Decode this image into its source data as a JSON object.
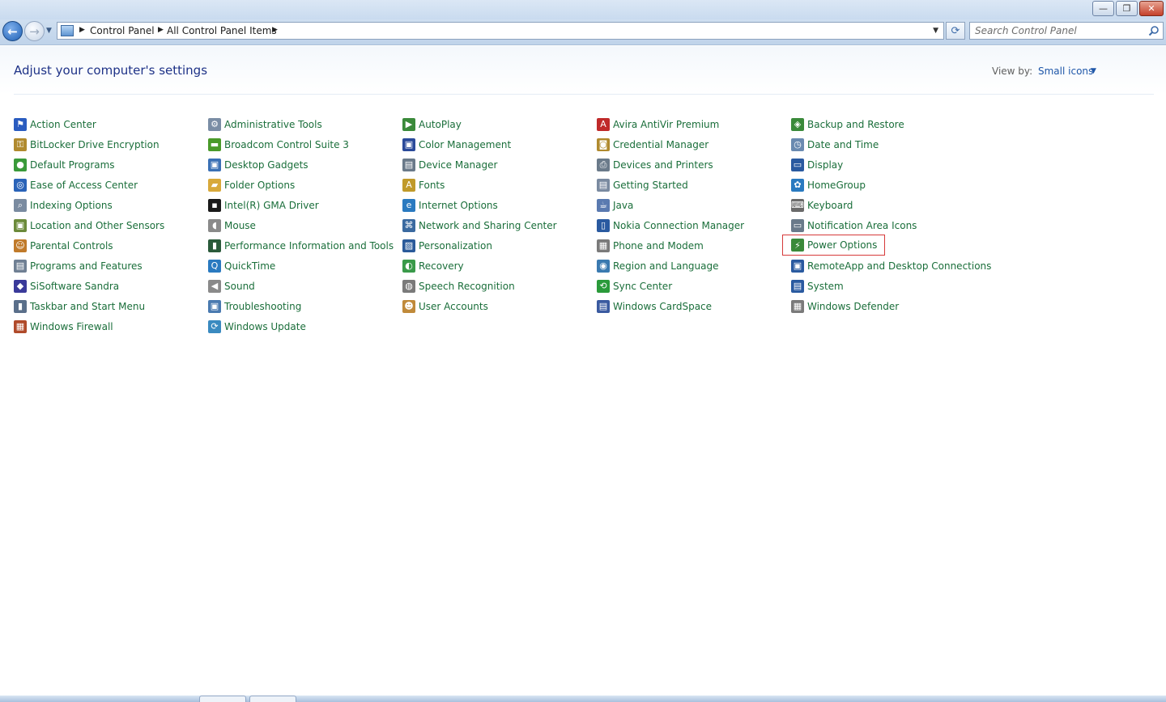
{
  "window": {
    "minimize_glyph": "—",
    "maximize_glyph": "❐",
    "close_glyph": "✕"
  },
  "nav": {
    "back_glyph": "←",
    "forward_glyph": "→",
    "breadcrumbs": [
      "Control Panel",
      "All Control Panel Items"
    ],
    "refresh_glyph": "⟳",
    "search_placeholder": "Search Control Panel"
  },
  "header": {
    "title": "Adjust your computer's settings",
    "view_by_label": "View by:",
    "view_by_value": "Small icons"
  },
  "columns": [
    [
      {
        "label": "Action Center",
        "icon": "flag-icon",
        "glyph": "⚑",
        "color": "#2a5cc0"
      },
      {
        "label": "BitLocker Drive Encryption",
        "icon": "key-icon",
        "glyph": "⚿",
        "color": "#b08a2e"
      },
      {
        "label": "Default Programs",
        "icon": "default-programs-icon",
        "glyph": "●",
        "color": "#3a9a3a"
      },
      {
        "label": "Ease of Access Center",
        "icon": "ease-of-access-icon",
        "glyph": "◎",
        "color": "#2a63b8"
      },
      {
        "label": "Indexing Options",
        "icon": "indexing-icon",
        "glyph": "⌕",
        "color": "#7a8ba0"
      },
      {
        "label": "Location and Other Sensors",
        "icon": "sensor-icon",
        "glyph": "▣",
        "color": "#6b8a3a"
      },
      {
        "label": "Parental Controls",
        "icon": "parental-controls-icon",
        "glyph": "☺",
        "color": "#c07a2a"
      },
      {
        "label": "Programs and Features",
        "icon": "programs-icon",
        "glyph": "▤",
        "color": "#6f7f93"
      },
      {
        "label": "SiSoftware Sandra",
        "icon": "sandra-icon",
        "glyph": "◆",
        "color": "#3a3a9a"
      },
      {
        "label": "Taskbar and Start Menu",
        "icon": "taskbar-icon",
        "glyph": "▮",
        "color": "#5a6f8a"
      },
      {
        "label": "Windows Firewall",
        "icon": "firewall-icon",
        "glyph": "▦",
        "color": "#b04a2a"
      }
    ],
    [
      {
        "label": "Administrative Tools",
        "icon": "admin-tools-icon",
        "glyph": "⚙",
        "color": "#7a8da5"
      },
      {
        "label": "Broadcom Control Suite 3",
        "icon": "broadcom-icon",
        "glyph": "▬",
        "color": "#4a9a2a"
      },
      {
        "label": "Desktop Gadgets",
        "icon": "gadgets-icon",
        "glyph": "▣",
        "color": "#3a70b5"
      },
      {
        "label": "Folder Options",
        "icon": "folder-icon",
        "glyph": "▰",
        "color": "#d8a93a"
      },
      {
        "label": "Intel(R) GMA Driver",
        "icon": "intel-icon",
        "glyph": "▪",
        "color": "#1a1a1a"
      },
      {
        "label": "Mouse",
        "icon": "mouse-icon",
        "glyph": "◖",
        "color": "#8a8a8a"
      },
      {
        "label": "Performance Information and Tools",
        "icon": "performance-icon",
        "glyph": "▮",
        "color": "#2a5a3a"
      },
      {
        "label": "QuickTime",
        "icon": "quicktime-icon",
        "glyph": "Q",
        "color": "#2a7ac0"
      },
      {
        "label": "Sound",
        "icon": "speaker-icon",
        "glyph": "◀",
        "color": "#8a8a8a"
      },
      {
        "label": "Troubleshooting",
        "icon": "troubleshooting-icon",
        "glyph": "▣",
        "color": "#4a7ab0"
      },
      {
        "label": "Windows Update",
        "icon": "windows-update-icon",
        "glyph": "⟳",
        "color": "#3a8ac0"
      }
    ],
    [
      {
        "label": "AutoPlay",
        "icon": "autoplay-icon",
        "glyph": "▶",
        "color": "#3a8a3a"
      },
      {
        "label": "Color Management",
        "icon": "color-management-icon",
        "glyph": "▣",
        "color": "#2a4a9a"
      },
      {
        "label": "Device Manager",
        "icon": "device-manager-icon",
        "glyph": "▤",
        "color": "#6a7a8a"
      },
      {
        "label": "Fonts",
        "icon": "fonts-icon",
        "glyph": "A",
        "color": "#c09a2a"
      },
      {
        "label": "Internet Options",
        "icon": "internet-options-icon",
        "glyph": "e",
        "color": "#2a7ac0"
      },
      {
        "label": "Network and Sharing Center",
        "icon": "network-icon",
        "glyph": "⌘",
        "color": "#3a6aa0"
      },
      {
        "label": "Personalization",
        "icon": "personalization-icon",
        "glyph": "▨",
        "color": "#2a5a9a"
      },
      {
        "label": "Recovery",
        "icon": "recovery-icon",
        "glyph": "◐",
        "color": "#3a9a4a"
      },
      {
        "label": "Speech Recognition",
        "icon": "microphone-icon",
        "glyph": "◍",
        "color": "#7a7a7a"
      },
      {
        "label": "User Accounts",
        "icon": "user-accounts-icon",
        "glyph": "☻",
        "color": "#c08a3a"
      }
    ],
    [
      {
        "label": "Avira AntiVir Premium",
        "icon": "avira-icon",
        "glyph": "A",
        "color": "#c02a2a"
      },
      {
        "label": "Credential Manager",
        "icon": "credential-icon",
        "glyph": "◙",
        "color": "#b08a2e"
      },
      {
        "label": "Devices and Printers",
        "icon": "printer-icon",
        "glyph": "⎙",
        "color": "#6a7a8a"
      },
      {
        "label": "Getting Started",
        "icon": "getting-started-icon",
        "glyph": "▤",
        "color": "#7a8aa0"
      },
      {
        "label": "Java",
        "icon": "java-icon",
        "glyph": "☕",
        "color": "#5a7ab0"
      },
      {
        "label": "Nokia Connection Manager",
        "icon": "nokia-icon",
        "glyph": "▯",
        "color": "#2a5aa0"
      },
      {
        "label": "Phone and Modem",
        "icon": "phone-icon",
        "glyph": "▦",
        "color": "#7a7a7a"
      },
      {
        "label": "Region and Language",
        "icon": "globe-icon",
        "glyph": "◉",
        "color": "#3a7ab0"
      },
      {
        "label": "Sync Center",
        "icon": "sync-icon",
        "glyph": "⟲",
        "color": "#2a9a3a"
      },
      {
        "label": "Windows CardSpace",
        "icon": "cardspace-icon",
        "glyph": "▤",
        "color": "#3a5aa0"
      }
    ],
    [
      {
        "label": "Backup and Restore",
        "icon": "backup-icon",
        "glyph": "◈",
        "color": "#3a8a3a"
      },
      {
        "label": "Date and Time",
        "icon": "clock-icon",
        "glyph": "◷",
        "color": "#6a8ab0"
      },
      {
        "label": "Display",
        "icon": "display-icon",
        "glyph": "▭",
        "color": "#2a5aa0"
      },
      {
        "label": "HomeGroup",
        "icon": "homegroup-icon",
        "glyph": "✿",
        "color": "#2a7ac0"
      },
      {
        "label": "Keyboard",
        "icon": "keyboard-icon",
        "glyph": "⌨",
        "color": "#6a6a6a"
      },
      {
        "label": "Notification Area Icons",
        "icon": "notification-icon",
        "glyph": "▭",
        "color": "#6a7a8a"
      },
      {
        "label": "Power Options",
        "icon": "power-icon",
        "glyph": "⚡",
        "color": "#3a8a3a",
        "selected": true
      },
      {
        "label": "RemoteApp and Desktop Connections",
        "icon": "remoteapp-icon",
        "glyph": "▣",
        "color": "#2a5aa0"
      },
      {
        "label": "System",
        "icon": "system-icon",
        "glyph": "▤",
        "color": "#2a5aa0"
      },
      {
        "label": "Windows Defender",
        "icon": "defender-icon",
        "glyph": "▦",
        "color": "#7a7a7a"
      }
    ]
  ]
}
